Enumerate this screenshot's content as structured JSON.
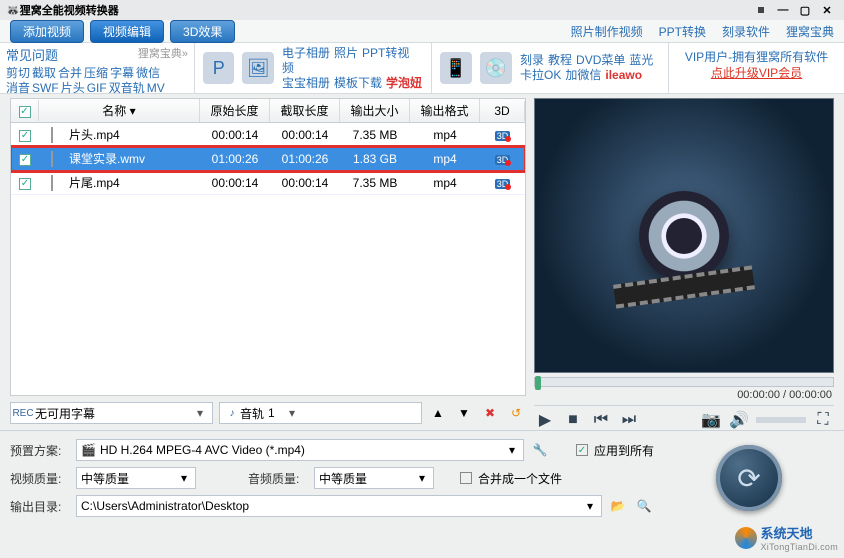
{
  "title": "狸窝全能视频转换器",
  "topbar": {
    "add": "添加视频",
    "edit": "视频编辑",
    "fx": "3D效果",
    "links": [
      "照片制作视频",
      "PPT转换",
      "刻录软件",
      "狸窝宝典"
    ]
  },
  "faq": {
    "title": "常见问题",
    "corner": "狸窝宝典»",
    "row1": [
      "剪切",
      "截取",
      "合并",
      "压缩",
      "字幕",
      "微信"
    ],
    "row2": [
      "消音",
      "SWF",
      "片头",
      "GIF",
      "双音轨",
      "MV"
    ]
  },
  "promo1": {
    "row1": [
      "电子相册",
      "照片",
      "PPT转视频"
    ],
    "row2a": [
      "宝宝相册",
      "模板下载"
    ],
    "row2b": "学泡妞"
  },
  "promo2": {
    "row1": [
      "刻录",
      "教程",
      "DVD菜单",
      "蓝光"
    ],
    "row2a": [
      "卡拉OK",
      "加微信"
    ],
    "row2b": "ileawo"
  },
  "vip": {
    "line1": "VIP用户-拥有狸窝所有软件",
    "line2": "点此升级VIP会员"
  },
  "table": {
    "headers": {
      "name": "名称",
      "dur": "原始长度",
      "dur2": "截取长度",
      "size": "输出大小",
      "fmt": "输出格式",
      "three": "3D"
    },
    "rows": [
      {
        "name": "片头.mp4",
        "dur": "00:00:14",
        "dur2": "00:00:14",
        "size": "7.35 MB",
        "fmt": "mp4",
        "sel": false
      },
      {
        "name": "课堂实录.wmv",
        "dur": "01:00:26",
        "dur2": "01:00:26",
        "size": "1.83 GB",
        "fmt": "mp4",
        "sel": true
      },
      {
        "name": "片尾.mp4",
        "dur": "00:00:14",
        "dur2": "00:00:14",
        "size": "7.35 MB",
        "fmt": "mp4",
        "sel": false
      }
    ]
  },
  "subbar": {
    "subtitle": "无可用字幕",
    "audio_label": "音轨",
    "audio_val": "1"
  },
  "preview": {
    "time": "00:00:00 / 00:00:00"
  },
  "bottom": {
    "preset_label": "预置方案:",
    "preset": "HD H.264 MPEG-4 AVC Video (*.mp4)",
    "vq_label": "视频质量:",
    "vq": "中等质量",
    "aq_label": "音频质量:",
    "aq": "中等质量",
    "out_label": "输出目录:",
    "out": "C:\\Users\\Administrator\\Desktop",
    "apply": "应用到所有",
    "merge": "合并成一个文件"
  },
  "watermark": {
    "main": "系统天地",
    "sub": "XiTongTianDi.com"
  }
}
